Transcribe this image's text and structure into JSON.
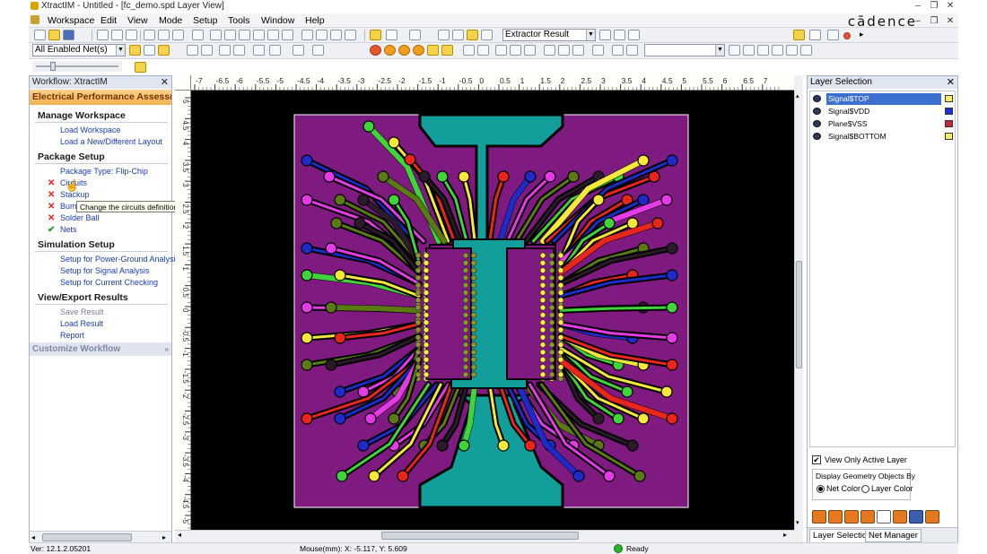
{
  "window": {
    "title": "XtractIM - Untitled - [fc_demo.spd Layer View]",
    "brand": "cādence",
    "controls": [
      "minimize",
      "restore",
      "close"
    ]
  },
  "menu": [
    "Workspace",
    "Edit",
    "View",
    "Mode",
    "Setup",
    "Tools",
    "Window",
    "Help"
  ],
  "toolbar": {
    "result_combo": "Extractor Result",
    "net_filter_combo": "All Enabled Net(s)",
    "search_combo": ""
  },
  "workflow": {
    "header": "Workflow: XtractIM",
    "section": "Electrical Performance Assessme",
    "groups": [
      {
        "title": "Manage Workspace",
        "items": [
          {
            "label": "Load Workspace",
            "status": ""
          },
          {
            "label": "Load a New/Different Layout",
            "status": ""
          }
        ]
      },
      {
        "title": "Package Setup",
        "items": [
          {
            "label": "Package Type: Flip-Chip",
            "status": ""
          },
          {
            "label": "Circuits",
            "status": "incomplete"
          },
          {
            "label": "Stackup",
            "status": "incomplete"
          },
          {
            "label": "Bump",
            "status": "incomplete"
          },
          {
            "label": "Solder Ball",
            "status": "incomplete"
          },
          {
            "label": "Nets",
            "status": "complete"
          }
        ]
      },
      {
        "title": "Simulation Setup",
        "items": [
          {
            "label": "Setup for Power-Ground Analysis",
            "status": ""
          },
          {
            "label": "Setup for Signal Analysis",
            "status": ""
          },
          {
            "label": "Setup for Current Checking",
            "status": ""
          }
        ]
      },
      {
        "title": "View/Export Results",
        "items": [
          {
            "label": "Save Result",
            "status": "disabled"
          },
          {
            "label": "Load Result",
            "status": ""
          },
          {
            "label": "Report",
            "status": ""
          }
        ]
      }
    ],
    "customize": "Customize Workflow",
    "tooltip": "Change the circuits definition."
  },
  "ruler": {
    "top_ticks": [
      "-7",
      "-6.5",
      "-6",
      "-5.5",
      "-5",
      "-4.5",
      "-4",
      "-3.5",
      "-3",
      "-2.5",
      "-2",
      "-1.5",
      "-1",
      "-0.5",
      "0",
      "0.5",
      "1",
      "1.5",
      "2",
      "2.5",
      "3",
      "3.5",
      "4",
      "4.5",
      "5",
      "5.5",
      "6",
      "6.5",
      "7"
    ],
    "left_ticks": [
      "5",
      "4.5",
      "4",
      "3.5",
      "3",
      "2.5",
      "2",
      "1.5",
      "1",
      "0.5",
      "0",
      "-0.5",
      "-1",
      "-1.5",
      "-2",
      "-2.5",
      "-3",
      "-3.5",
      "-4",
      "-4.5",
      "-5"
    ]
  },
  "layers": {
    "header": "Layer Selection",
    "items": [
      {
        "name": "Signal$TOP",
        "color": "#f5ef66",
        "selected": true
      },
      {
        "name": "Signal$VDD",
        "color": "#1a2fd8",
        "selected": false
      },
      {
        "name": "Plane$VSS",
        "color": "#c0283a",
        "selected": false
      },
      {
        "name": "Signal$BOTTOM",
        "color": "#f5ef66",
        "selected": false
      }
    ],
    "view_only_active": "View Only Active Layer",
    "display_group": "Display Geometry Objects By",
    "option_net_color": "Net Color",
    "option_layer_color": "Layer Color",
    "tabs": [
      "Layer Selection",
      "Net Manager"
    ]
  },
  "status": {
    "version": "Ver: 12.1.2.05201",
    "mouse": "Mouse(mm): X: -5.117, Y: 5.609",
    "state": "Ready"
  },
  "colors": {
    "board": "#7e1a80",
    "plane": "#129e9b",
    "trace_red": "#e8261c",
    "trace_green": "#3fd43a",
    "trace_blue": "#1d2bc8",
    "trace_yellow": "#f4e93a",
    "trace_magenta": "#e43be6",
    "trace_olive": "#5b7a15",
    "trace_dark": "#2a1a2a"
  }
}
